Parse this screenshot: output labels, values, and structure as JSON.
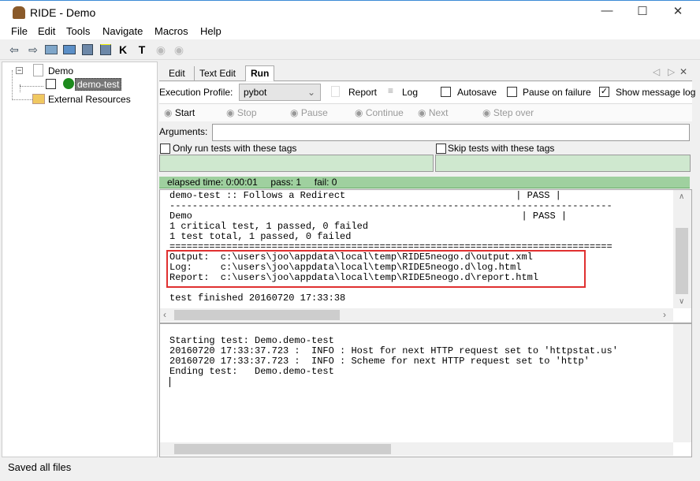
{
  "window": {
    "title": "RIDE - Demo",
    "minimize": "—",
    "maximize": "☐",
    "close": "✕"
  },
  "menu": [
    "File",
    "Edit",
    "Tools",
    "Navigate",
    "Macros",
    "Help"
  ],
  "toolbar_icons": [
    "back-arrow-icon",
    "forward-arrow-icon",
    "open-suite-icon",
    "open-directory-icon",
    "save-icon",
    "save-all-icon",
    "search-keywords-icon",
    "search-tests-icon",
    "run-icon",
    "stop-icon"
  ],
  "tree": {
    "root": "Demo",
    "child": "demo-test",
    "resources": "External Resources"
  },
  "tabs": [
    "Edit",
    "Text Edit",
    "Run"
  ],
  "tab_nav": {
    "prev": "◁",
    "next": "▷",
    "close": "✕"
  },
  "run": {
    "profile_label": "Execution Profile:",
    "profile_value": "pybot",
    "report": "Report",
    "log": "Log",
    "autosave": "Autosave",
    "pause_on_failure": "Pause on failure",
    "show_message_log": "Show message log",
    "show_message_log_checked": true,
    "buttons": [
      "Start",
      "Stop",
      "Pause",
      "Continue",
      "Next",
      "Step over"
    ],
    "arguments_label": "Arguments:",
    "arguments_value": "",
    "only_tags": "Only run tests with these tags",
    "skip_tags": "Skip tests with these tags",
    "status": "elapsed time: 0:00:01     pass: 1     fail: 0",
    "status_color": "#9fd09f"
  },
  "output_lines": [
    "demo-test :: Follows a Redirect                              | PASS |",
    "------------------------------------------------------------------------------",
    "Demo                                                          | PASS |",
    "1 critical test, 1 passed, 0 failed",
    "1 test total, 1 passed, 0 failed",
    "==============================================================================",
    "Output:  c:\\users\\joo\\appdata\\local\\temp\\RIDE5neogo.d\\output.xml",
    "Log:     c:\\users\\joo\\appdata\\local\\temp\\RIDE5neogo.d\\log.html",
    "Report:  c:\\users\\joo\\appdata\\local\\temp\\RIDE5neogo.d\\report.html",
    "",
    "test finished 20160720 17:33:38"
  ],
  "message_lines": [
    "Starting test: Demo.demo-test",
    "20160720 17:33:37.723 :  INFO : Host for next HTTP request set to 'httpstat.us'",
    "20160720 17:33:37.723 :  INFO : Scheme for next HTTP request set to 'http'",
    "Ending test:   Demo.demo-test"
  ],
  "highlight_color": "#e03030",
  "statusbar": "Saved all files"
}
